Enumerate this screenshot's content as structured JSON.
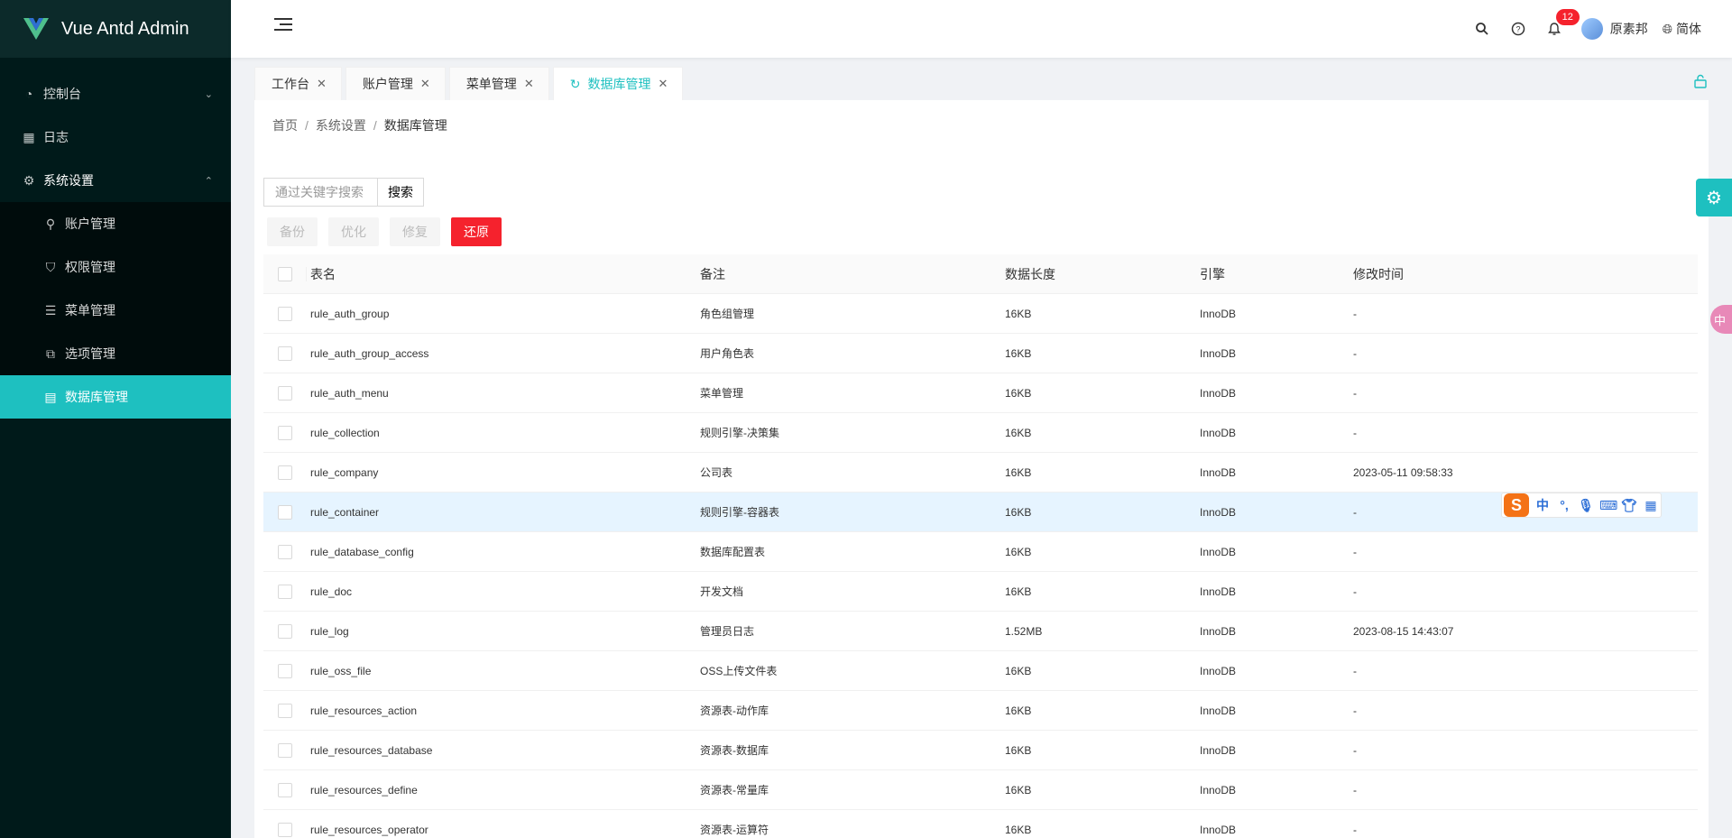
{
  "app": {
    "title": "Vue Antd Admin"
  },
  "sidebar": {
    "items": [
      {
        "label": "控制台",
        "icon": "dashboard-icon",
        "expandable": true,
        "chevron": "⌄"
      },
      {
        "label": "日志",
        "icon": "table-icon"
      },
      {
        "label": "系统设置",
        "icon": "gear-icon",
        "expandable": true,
        "open": true,
        "chevron": "⌃"
      }
    ],
    "submenu": [
      {
        "label": "账户管理",
        "icon": "user-icon"
      },
      {
        "label": "权限管理",
        "icon": "shield-icon"
      },
      {
        "label": "菜单管理",
        "icon": "menu-icon"
      },
      {
        "label": "选项管理",
        "icon": "options-icon"
      },
      {
        "label": "数据库管理",
        "icon": "database-icon",
        "active": true
      }
    ]
  },
  "header": {
    "notification_count": "12",
    "username": "原素邦",
    "language": "简体"
  },
  "tabs": [
    {
      "label": "工作台"
    },
    {
      "label": "账户管理"
    },
    {
      "label": "菜单管理"
    },
    {
      "label": "数据库管理",
      "active": true
    }
  ],
  "breadcrumb": [
    "首页",
    "系统设置",
    "数据库管理"
  ],
  "search": {
    "placeholder": "通过关键字搜索",
    "button": "搜索"
  },
  "actions": {
    "backup": "备份",
    "optimize": "优化",
    "repair": "修复",
    "restore": "还原"
  },
  "table": {
    "headers": {
      "name": "表名",
      "note": "备注",
      "size": "数据长度",
      "engine": "引擎",
      "modified": "修改时间"
    },
    "rows": [
      {
        "name": "rule_auth_group",
        "note": "角色组管理",
        "size": "16KB",
        "engine": "InnoDB",
        "modified": "-"
      },
      {
        "name": "rule_auth_group_access",
        "note": "用户角色表",
        "size": "16KB",
        "engine": "InnoDB",
        "modified": "-"
      },
      {
        "name": "rule_auth_menu",
        "note": "菜单管理",
        "size": "16KB",
        "engine": "InnoDB",
        "modified": "-"
      },
      {
        "name": "rule_collection",
        "note": "规则引擎-决策集",
        "size": "16KB",
        "engine": "InnoDB",
        "modified": "-"
      },
      {
        "name": "rule_company",
        "note": "公司表",
        "size": "16KB",
        "engine": "InnoDB",
        "modified": "2023-05-11 09:58:33"
      },
      {
        "name": "rule_container",
        "note": "规则引擎-容器表",
        "size": "16KB",
        "engine": "InnoDB",
        "modified": "-"
      },
      {
        "name": "rule_database_config",
        "note": "数据库配置表",
        "size": "16KB",
        "engine": "InnoDB",
        "modified": "-"
      },
      {
        "name": "rule_doc",
        "note": "开发文档",
        "size": "16KB",
        "engine": "InnoDB",
        "modified": "-"
      },
      {
        "name": "rule_log",
        "note": "管理员日志",
        "size": "1.52MB",
        "engine": "InnoDB",
        "modified": "2023-08-15 14:43:07"
      },
      {
        "name": "rule_oss_file",
        "note": "OSS上传文件表",
        "size": "16KB",
        "engine": "InnoDB",
        "modified": "-"
      },
      {
        "name": "rule_resources_action",
        "note": "资源表-动作库",
        "size": "16KB",
        "engine": "InnoDB",
        "modified": "-"
      },
      {
        "name": "rule_resources_database",
        "note": "资源表-数据库",
        "size": "16KB",
        "engine": "InnoDB",
        "modified": "-"
      },
      {
        "name": "rule_resources_define",
        "note": "资源表-常量库",
        "size": "16KB",
        "engine": "InnoDB",
        "modified": "-"
      },
      {
        "name": "rule_resources_operator",
        "note": "资源表-运算符",
        "size": "16KB",
        "engine": "InnoDB",
        "modified": "-"
      }
    ]
  },
  "ime": {
    "mode": "中",
    "side_label": "中"
  },
  "colors": {
    "accent": "#1ec0c0",
    "danger": "#f5222d",
    "sidebar_bg": "#001a1a"
  }
}
